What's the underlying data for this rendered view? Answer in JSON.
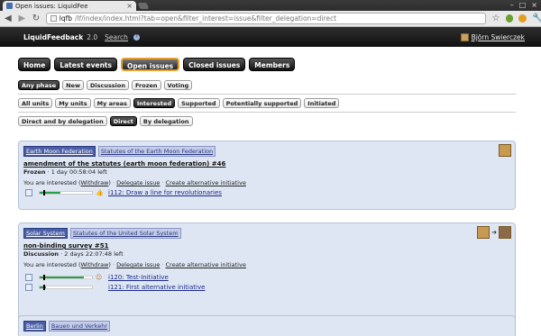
{
  "browser": {
    "tab_title": "Open issues: LiquidFee",
    "tab_close": "×",
    "window_buttons": [
      "–",
      "□",
      "×"
    ],
    "url_host": "lqfb",
    "url_rest": "/lf/index/index.html?tab=open&filter_interest=issue&filter_delegation=direct",
    "icons": {
      "back": "back-arrow-icon",
      "forward": "forward-arrow-icon",
      "reload": "reload-icon",
      "star": "star-icon",
      "wrench": "wrench-icon"
    }
  },
  "topbar": {
    "logo": "LiquidFeedback",
    "version": "2.0",
    "search_label": "Search",
    "help_icon": "?",
    "user_name": "Björn Swierczek"
  },
  "main_nav": [
    {
      "label": "Home",
      "active": false
    },
    {
      "label": "Latest events",
      "active": false
    },
    {
      "label": "Open issues",
      "active": true
    },
    {
      "label": "Closed issues",
      "active": false
    },
    {
      "label": "Members",
      "active": false
    }
  ],
  "phase_filters": [
    {
      "label": "Any phase",
      "selected": true
    },
    {
      "label": "New",
      "selected": false
    },
    {
      "label": "Discussion",
      "selected": false
    },
    {
      "label": "Frozen",
      "selected": false
    },
    {
      "label": "Voting",
      "selected": false
    }
  ],
  "interest_filters": [
    {
      "label": "All units",
      "selected": false
    },
    {
      "label": "My units",
      "selected": false
    },
    {
      "label": "My areas",
      "selected": false
    },
    {
      "label": "Interested",
      "selected": true
    },
    {
      "label": "Supported",
      "selected": false
    },
    {
      "label": "Potentially supported",
      "selected": false
    },
    {
      "label": "Initiated",
      "selected": false
    }
  ],
  "delegation_filters": [
    {
      "label": "Direct and by delegation",
      "selected": false
    },
    {
      "label": "Direct",
      "selected": true
    },
    {
      "label": "By delegation",
      "selected": false
    }
  ],
  "issues": [
    {
      "area": "Earth Moon Federation",
      "policy": "Statutes of the Earth Moon Federation",
      "name": "amendment of the statutes (earth moon federation) #46",
      "state": "Frozen",
      "time_left": "· 1 day 00:58:04 left",
      "interest_text": "You are interested (",
      "withdraw": "Withdraw",
      "interest_close": ")",
      "delegate": "Delegate issue",
      "create_alt": "Create alternative initiative",
      "initiatives": [
        {
          "label": "i112: Draw a line for revolutionaries",
          "support": 0.4,
          "icon": "thumbs-up-icon"
        }
      ]
    },
    {
      "area": "Solar System",
      "policy": "Statutes of the United Solar System",
      "name": "non-binding survey #51",
      "state": "Discussion",
      "time_left": "· 2 days 22:07:48 left",
      "interest_text": "You are interested (",
      "withdraw": "Withdraw",
      "interest_close": ")",
      "delegate": "Delegate issue",
      "create_alt": "Create alternative initiative",
      "initiatives": [
        {
          "label": "i120: Test-Initiative",
          "support": 0.85,
          "icon": "person-icon"
        },
        {
          "label": "i121: First alternative initiative",
          "support": 0.12,
          "icon": ""
        }
      ]
    },
    {
      "area": "Berlin",
      "policy": "Bauen und Verkehr"
    }
  ],
  "separators": "·"
}
